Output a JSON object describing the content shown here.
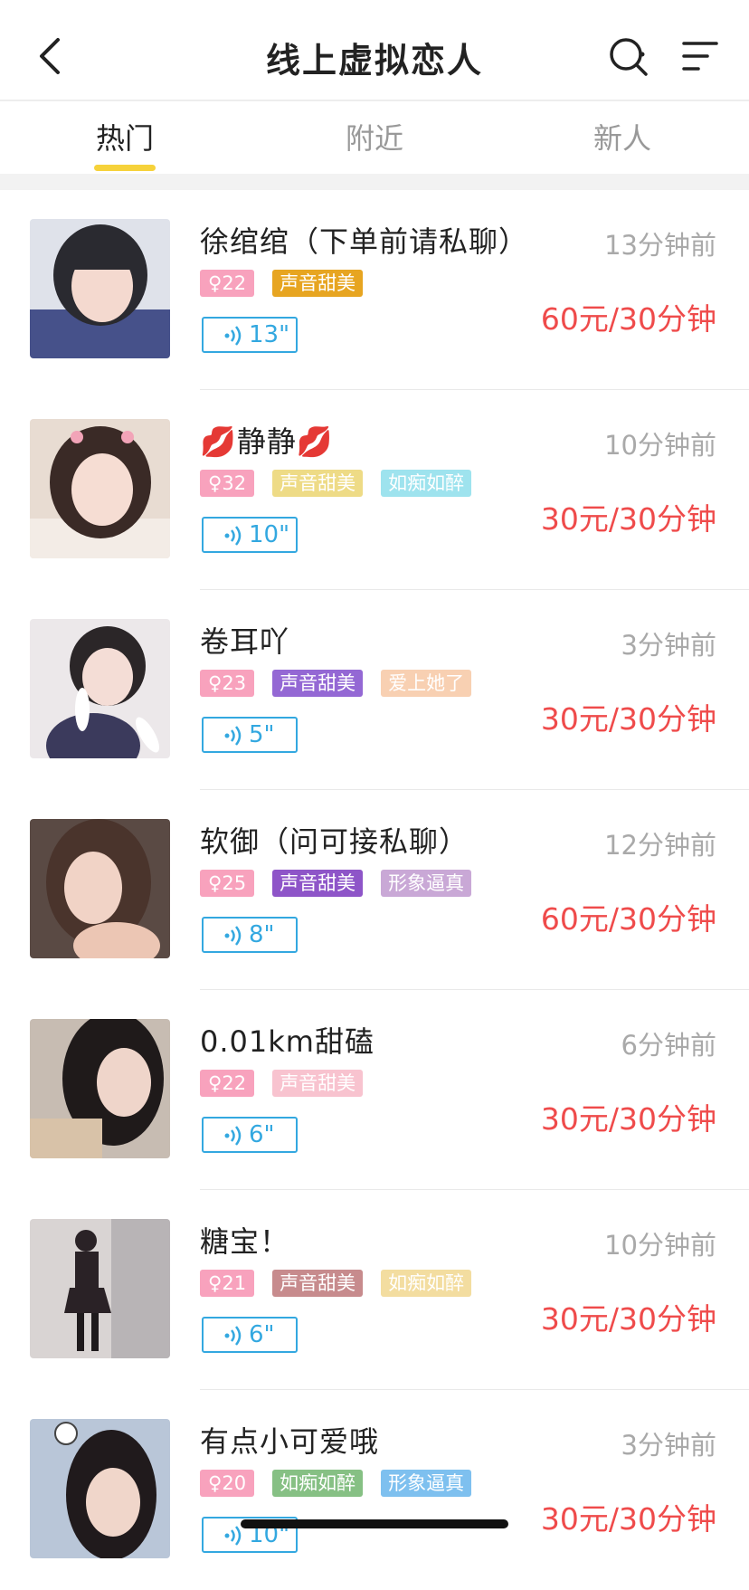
{
  "header": {
    "title": "线上虚拟恋人",
    "back_icon": "chevron-left-icon",
    "search_icon": "search-icon",
    "menu_icon": "filter-menu-icon"
  },
  "tabs": [
    {
      "label": "热门",
      "active": true
    },
    {
      "label": "附近",
      "active": false
    },
    {
      "label": "新人",
      "active": false
    }
  ],
  "colors": {
    "accent": "#f6d23a",
    "price": "#ef4b4b",
    "voice": "#33a8e0",
    "age_tag": "#f8a2bd"
  },
  "items": [
    {
      "name": "徐绾绾（下单前请私聊）",
      "age": "♀22",
      "tags": [
        {
          "label": "声音甜美",
          "color": "#e7a521"
        }
      ],
      "voice": "13\"",
      "time": "13分钟前",
      "price": "60元/30分钟"
    },
    {
      "name": "💋静静💋",
      "age": "♀32",
      "tags": [
        {
          "label": "声音甜美",
          "color": "#eedb86"
        },
        {
          "label": "如痴如醉",
          "color": "#9ee3ee"
        }
      ],
      "voice": "10\"",
      "time": "10分钟前",
      "price": "30元/30分钟"
    },
    {
      "name": "卷耳吖",
      "age": "♀23",
      "tags": [
        {
          "label": "声音甜美",
          "color": "#9468d4"
        },
        {
          "label": "爱上她了",
          "color": "#f8d0b2"
        }
      ],
      "voice": "5\"",
      "time": "3分钟前",
      "price": "30元/30分钟"
    },
    {
      "name": "软御（问可接私聊）",
      "age": "♀25",
      "tags": [
        {
          "label": "声音甜美",
          "color": "#8e55c8"
        },
        {
          "label": "形象逼真",
          "color": "#c9a8d6"
        }
      ],
      "voice": "8\"",
      "time": "12分钟前",
      "price": "60元/30分钟"
    },
    {
      "name": "0.01km甜磕",
      "age": "♀22",
      "tags": [
        {
          "label": "声音甜美",
          "color": "#f8c3cf"
        }
      ],
      "voice": "6\"",
      "time": "6分钟前",
      "price": "30元/30分钟"
    },
    {
      "name": "糖宝！",
      "age": "♀21",
      "tags": [
        {
          "label": "声音甜美",
          "color": "#c78b8d"
        },
        {
          "label": "如痴如醉",
          "color": "#f3dda0"
        }
      ],
      "voice": "6\"",
      "time": "10分钟前",
      "price": "30元/30分钟"
    },
    {
      "name": "有点小可爱哦",
      "age": "♀20",
      "tags": [
        {
          "label": "如痴如醉",
          "color": "#86c084"
        },
        {
          "label": "形象逼真",
          "color": "#7ec0ef"
        }
      ],
      "voice": "10\"",
      "time": "3分钟前",
      "price": "30元/30分钟"
    }
  ]
}
